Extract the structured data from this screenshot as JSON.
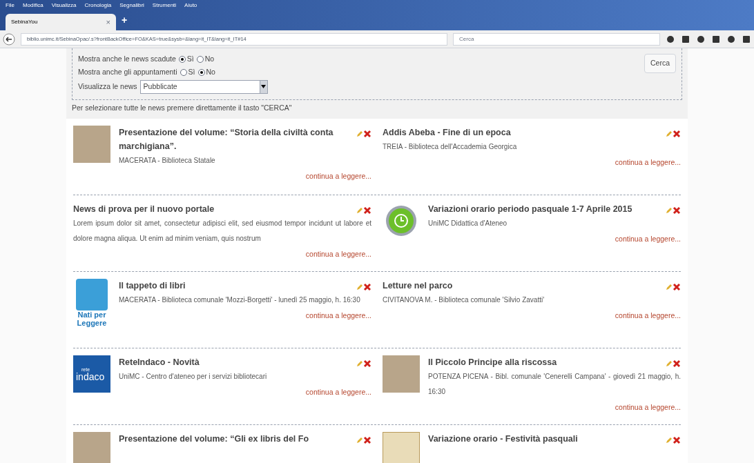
{
  "menu": [
    "File",
    "Modifica",
    "Visualizza",
    "Cronologia",
    "Segnalibri",
    "Strumenti",
    "Aiuto"
  ],
  "tab": {
    "title": "SebinaYou",
    "close": "×",
    "new": "+"
  },
  "address": "biblio.unimc.it/SebinaOpac/.s?frontBackOffice=FO&KAS=true&sysb=&lang=it_IT&lang=it_IT#14",
  "search": {
    "placeholder": "Cerca"
  },
  "filters": {
    "options": [
      {
        "label": "Mostra anche le news scadute",
        "choices": [
          {
            "label": "Sì",
            "selected": true
          },
          {
            "label": "No",
            "selected": false
          }
        ]
      },
      {
        "label": "Mostra anche gli appuntamenti",
        "choices": [
          {
            "label": "Sì",
            "selected": false
          },
          {
            "label": "No",
            "selected": true
          }
        ]
      }
    ],
    "view_label": "Visualizza le news",
    "view_value": "Pubblicate",
    "button": "Cerca",
    "hint": "Per selezionare tutte le news premere direttamente il tasto \"CERCA\""
  },
  "news": [
    {
      "kind": "photo",
      "title": "Presentazione del volume: “Storia della civiltà conta",
      "title_2": "marchigiana”.",
      "place": "MACERATA - Biblioteca Statale",
      "more": "continua a leggere..."
    },
    {
      "kind": "text",
      "title": "Addis Abeba - Fine di un epoca",
      "place": "TREIA - Biblioteca dell'Accademia Georgica",
      "more": "continua a leggere..."
    },
    {
      "kind": "text",
      "title": "News di prova per il nuovo portale",
      "place": "Lorem ipsum dolor sit amet, consectetur adipisci elit, sed eiusmod tempor incidunt ut labore et dolore magna aliqua. Ut enim ad minim veniam, quis nostrum",
      "more": "continua a leggere..."
    },
    {
      "kind": "clock",
      "title": "Variazioni orario periodo pasquale 1-7 Aprile 2015",
      "place": "UniMC   Didattica d'Ateneo",
      "more": "continua a leggere..."
    },
    {
      "kind": "npl",
      "logo": [
        "Nati per",
        "Leggere"
      ],
      "title": "Il tappeto di libri",
      "place": "MACERATA - Biblioteca comunale 'Mozzi-Borgetti' - lunedì 25 maggio, h. 16:30",
      "more": "continua a leggere..."
    },
    {
      "kind": "text",
      "title": "Letture nel parco",
      "place": "CIVITANOVA M. - Biblioteca comunale 'Silvio Zavatti'",
      "more": "continua a leggere..."
    },
    {
      "kind": "indaco",
      "logo": [
        "rete",
        "indaco"
      ],
      "title": "ReteIndaco - Novità",
      "place": "UniMC - Centro d'ateneo per i servizi bibliotecari",
      "more": "continua a leggere..."
    },
    {
      "kind": "photo",
      "title": "Il Piccolo Principe alla riscossa",
      "place": "POTENZA PICENA - Bibl. comunale 'Cenerelli Campana' - giovedì 21 maggio, h. 16:30",
      "more": "continua a leggere..."
    },
    {
      "kind": "photo",
      "title": "Presentazione del volume: “Gli ex libris del Fo"
    },
    {
      "kind": "clockface",
      "title": "Variazione orario - Festività pasquali"
    }
  ]
}
